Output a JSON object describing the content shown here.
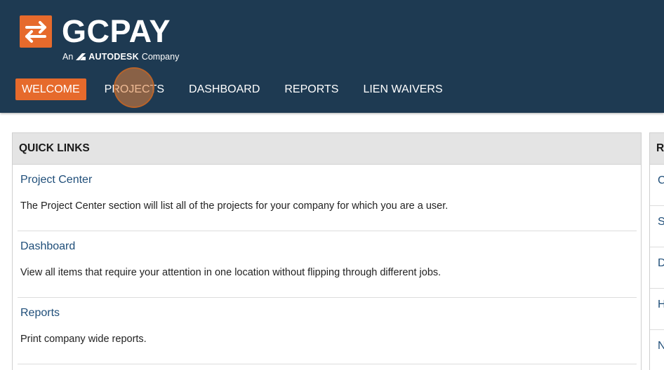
{
  "logo": {
    "wordmark": "GCPAY",
    "sub_prefix": "An",
    "sub_brand": "AUTODESK",
    "sub_suffix": "Company",
    "accent_color": "#e66a2c",
    "icon": "exchange-arrows-icon"
  },
  "nav": {
    "items": [
      {
        "label": "WELCOME",
        "active": true
      },
      {
        "label": "PROJECTS",
        "active": false
      },
      {
        "label": "DASHBOARD",
        "active": false
      },
      {
        "label": "REPORTS",
        "active": false
      },
      {
        "label": "LIEN WAIVERS",
        "active": false
      }
    ]
  },
  "quick_links": {
    "title": "QUICK LINKS",
    "items": [
      {
        "label": "Project Center",
        "description": "The Project Center section will list all of the projects for your company for which you are a user."
      },
      {
        "label": "Dashboard",
        "description": "View all items that require your attention in one location without flipping through different jobs."
      },
      {
        "label": "Reports",
        "description": "Print company wide reports."
      }
    ]
  },
  "right_panel": {
    "title": "R",
    "items": [
      "C",
      "S",
      "D",
      "H",
      "N"
    ]
  },
  "colors": {
    "header_bg": "#1e3a52",
    "link": "#1f4e79",
    "panel_head_bg": "#e4e4e4"
  }
}
